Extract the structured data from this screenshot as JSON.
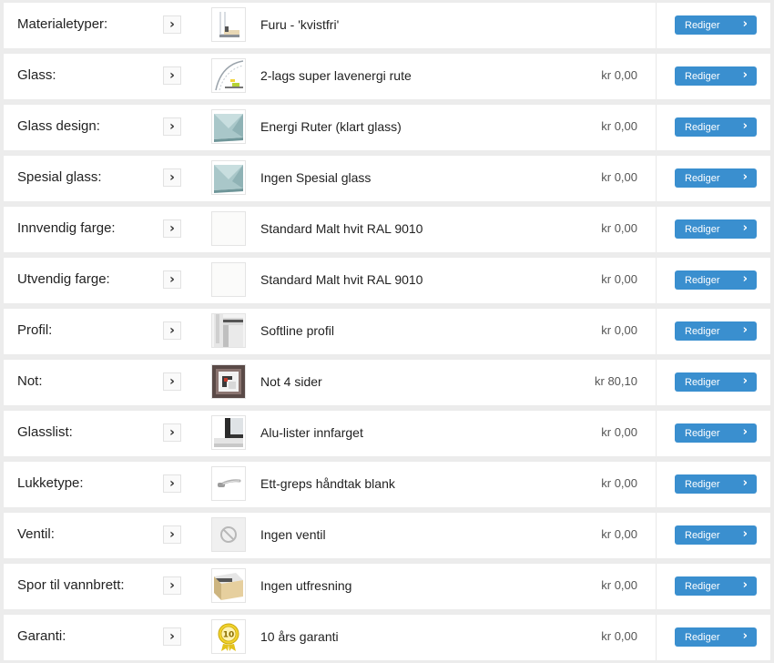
{
  "ui": {
    "edit_label": "Rediger",
    "arrow": "›"
  },
  "rows": [
    {
      "label": "Materialetyper:",
      "value": "Furu - 'kvistfri'",
      "price": "",
      "icon": "wood-window-frame-icon"
    },
    {
      "label": "Glass:",
      "value": "2-lags super lavenergi rute",
      "price": "kr 0,00",
      "icon": "glass-pane-icon"
    },
    {
      "label": "Glass design:",
      "value": "Energi Ruter (klart glass)",
      "price": "kr 0,00",
      "icon": "clear-glass-icon"
    },
    {
      "label": "Spesial glass:",
      "value": "Ingen Spesial glass",
      "price": "kr 0,00",
      "icon": "clear-glass-icon"
    },
    {
      "label": "Innvendig farge:",
      "value": "Standard Malt hvit RAL 9010",
      "price": "kr 0,00",
      "icon": "white-swatch-icon"
    },
    {
      "label": "Utvendig farge:",
      "value": "Standard Malt hvit RAL 9010",
      "price": "kr 0,00",
      "icon": "white-swatch-icon"
    },
    {
      "label": "Profil:",
      "value": "Softline profil",
      "price": "kr 0,00",
      "icon": "profile-corner-icon"
    },
    {
      "label": "Not:",
      "value": "Not 4 sider",
      "price": "kr 80,10",
      "icon": "groove-frame-icon"
    },
    {
      "label": "Glasslist:",
      "value": "Alu-lister innfarget",
      "price": "kr 0,00",
      "icon": "glazing-bead-icon"
    },
    {
      "label": "Lukketype:",
      "value": "Ett-greps håndtak blank",
      "price": "kr 0,00",
      "icon": "window-handle-icon"
    },
    {
      "label": "Ventil:",
      "value": "Ingen ventil",
      "price": "kr 0,00",
      "icon": "no-vent-icon"
    },
    {
      "label": "Spor til vannbrett:",
      "value": "Ingen utfresning",
      "price": "kr 0,00",
      "icon": "sill-groove-icon"
    },
    {
      "label": "Garanti:",
      "value": "10 års garanti",
      "price": "kr 0,00",
      "icon": "warranty-badge-icon"
    }
  ],
  "warranty_badge_text": "10"
}
